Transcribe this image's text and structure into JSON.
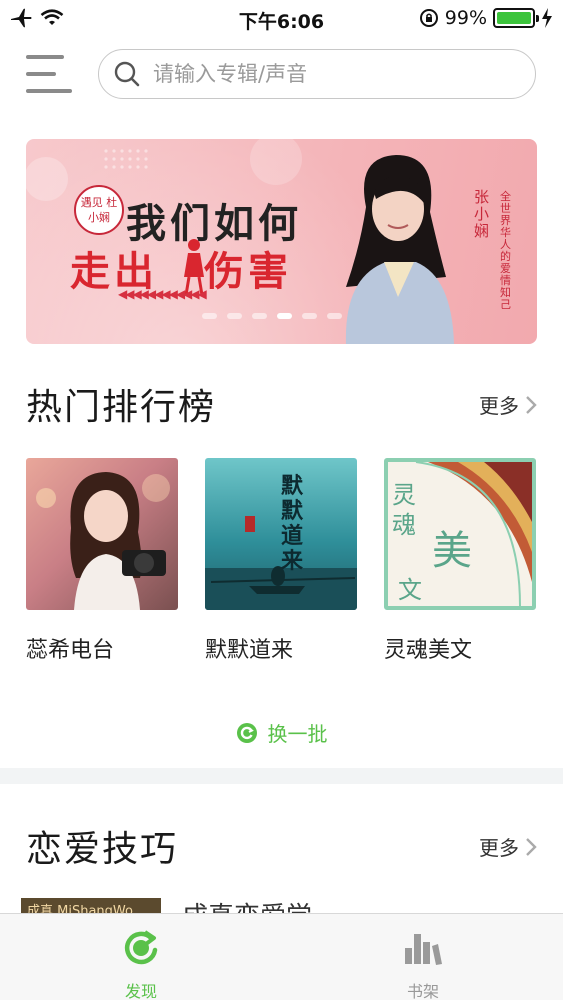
{
  "status_bar": {
    "time": "下午6:06",
    "battery_text": "99%",
    "battery_level": 0.99,
    "icons": [
      "airplane-icon",
      "wifi-icon",
      "rotation-lock-icon",
      "battery-icon",
      "charging-icon"
    ]
  },
  "header": {
    "search_placeholder": "请输入专辑/声音"
  },
  "banner": {
    "badge": "遇见 杜小娴",
    "line1": "我们如何",
    "line2_a": "走出",
    "line2_b": "伤害",
    "name": "张小娴",
    "slogan": "全世界华人的爱情知己",
    "slide_count": 6,
    "active_slide": 4
  },
  "hot_section": {
    "title": "热门排行榜",
    "more": "更多",
    "albums": [
      {
        "title": "蕊希电台"
      },
      {
        "title": "默默道来",
        "cover_text": "默默道来"
      },
      {
        "title": "灵魂美文",
        "cover_text_a": "灵魂",
        "cover_text_b": "美",
        "cover_text_c": "文"
      }
    ],
    "refresh": "换一批"
  },
  "love_section": {
    "title": "恋爱技巧",
    "more": "更多",
    "partial_item_text": "成真恋爱学",
    "partial_cover_text": "成真 MiShangWo"
  },
  "tabbar": {
    "tabs": [
      {
        "label": "发现",
        "active": true
      },
      {
        "label": "书架",
        "active": false
      }
    ]
  },
  "colors": {
    "accent": "#5ac14a",
    "inactive": "#999999",
    "banner_pink": "#f4b4b8",
    "banner_red": "#d9262f"
  }
}
